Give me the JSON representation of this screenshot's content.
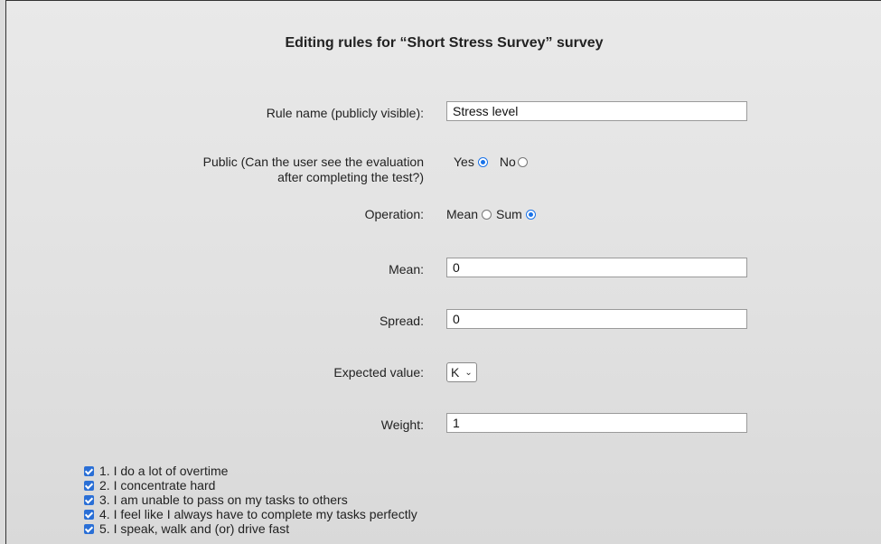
{
  "title": "Editing rules for “Short Stress Survey” survey",
  "form": {
    "rule_name": {
      "label": "Rule name (publicly visible):",
      "value": "Stress level"
    },
    "public": {
      "label_line1": "Public (Can the user see the evaluation",
      "label_line2": "after completing the test?)",
      "options": [
        {
          "label": "Yes",
          "checked": true
        },
        {
          "label": "No",
          "checked": false
        }
      ]
    },
    "operation": {
      "label": "Operation:",
      "options": [
        {
          "label": "Mean",
          "checked": false
        },
        {
          "label": "Sum",
          "checked": true
        }
      ]
    },
    "mean": {
      "label": "Mean:",
      "value": "0"
    },
    "spread": {
      "label": "Spread:",
      "value": "0"
    },
    "expected_value": {
      "label": "Expected value:",
      "selected": "K"
    },
    "weight": {
      "label": "Weight:",
      "value": "1"
    }
  },
  "questions": [
    {
      "label": "1. I do a lot of overtime",
      "checked": true
    },
    {
      "label": "2. I concentrate hard",
      "checked": true
    },
    {
      "label": "3. I am unable to pass on my tasks to others",
      "checked": true
    },
    {
      "label": "4. I feel like I always have to complete my tasks perfectly",
      "checked": true
    },
    {
      "label": "5. I speak, walk and (or) drive fast",
      "checked": true
    }
  ],
  "colors": {
    "accent": "#2a6fd6",
    "radio_checked": "#1a73e8"
  }
}
